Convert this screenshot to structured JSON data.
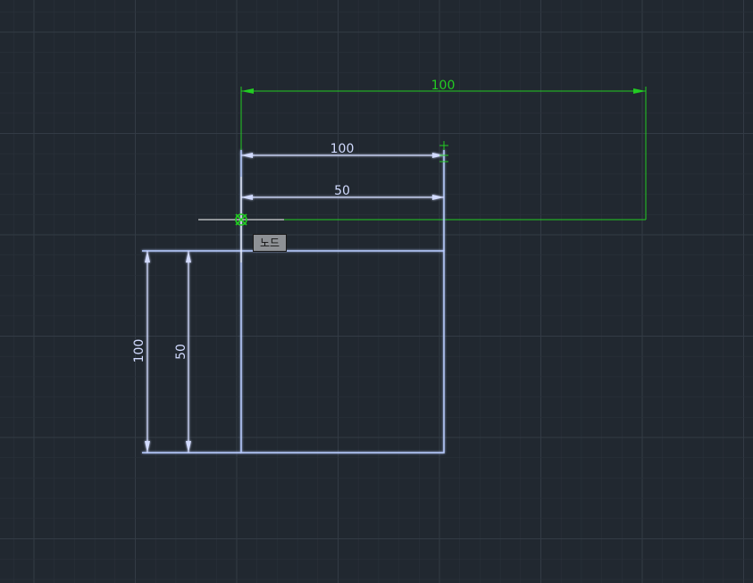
{
  "colors": {
    "background": "#212830",
    "grid_minor": "#2a313a",
    "grid_major": "#333b45",
    "geometry": "#b8ccff",
    "dimension": "#d2dbff",
    "preview": "#22cc22",
    "cursor": "#ffffff"
  },
  "dimensions": {
    "preview_horizontal": "100",
    "top_horizontal": "100",
    "inner_horizontal": "50",
    "outer_vertical": "100",
    "inner_vertical": "50"
  },
  "tooltip": {
    "label": "노드"
  },
  "icons": {
    "snap_marker": "node-snap-icon",
    "crosshair": "crosshair-cursor-icon"
  }
}
